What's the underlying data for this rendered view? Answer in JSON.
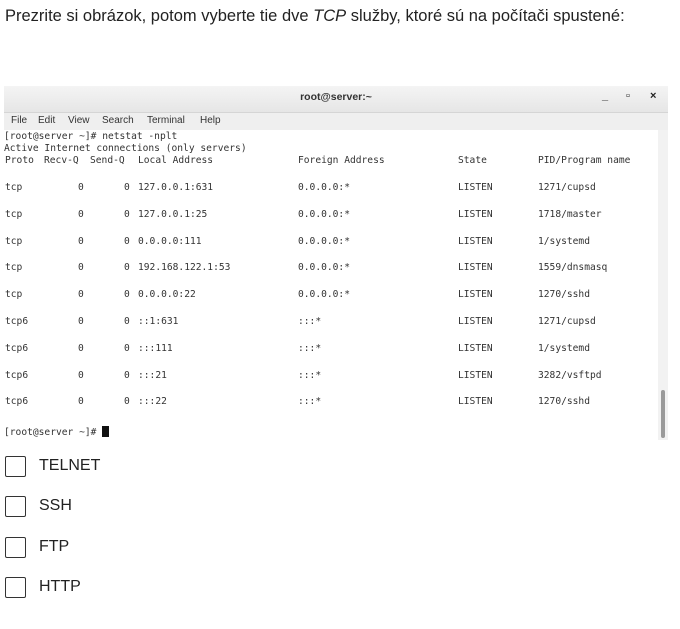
{
  "question": {
    "text_before": "Prezrite si obrázok, potom vyberte tie dve ",
    "text_emphasis": "TCP",
    "text_after": " služby, ktoré sú na počítači spustené:"
  },
  "terminal": {
    "title": "root@server:~",
    "window_controls": [
      "_",
      "▫",
      "×"
    ],
    "menu": [
      "File",
      "Edit",
      "View",
      "Search",
      "Terminal",
      "Help"
    ],
    "command_line": "[root@server ~]# netstat -nplt",
    "active_line": "Active Internet connections (only servers)",
    "headers": {
      "proto": "Proto",
      "recvq": "Recv-Q",
      "sendq": "Send-Q",
      "local": "Local Address",
      "foreign": "Foreign Address",
      "state": "State",
      "pid": "PID/Program name"
    },
    "rows": [
      {
        "proto": "tcp",
        "recvq": "0",
        "sendq": "0",
        "local": "127.0.0.1:631",
        "foreign": "0.0.0.0:*",
        "state": "LISTEN",
        "pid": "1271/cupsd"
      },
      {
        "proto": "tcp",
        "recvq": "0",
        "sendq": "0",
        "local": "127.0.0.1:25",
        "foreign": "0.0.0.0:*",
        "state": "LISTEN",
        "pid": "1718/master"
      },
      {
        "proto": "tcp",
        "recvq": "0",
        "sendq": "0",
        "local": "0.0.0.0:111",
        "foreign": "0.0.0.0:*",
        "state": "LISTEN",
        "pid": "1/systemd"
      },
      {
        "proto": "tcp",
        "recvq": "0",
        "sendq": "0",
        "local": "192.168.122.1:53",
        "foreign": "0.0.0.0:*",
        "state": "LISTEN",
        "pid": "1559/dnsmasq"
      },
      {
        "proto": "tcp",
        "recvq": "0",
        "sendq": "0",
        "local": "0.0.0.0:22",
        "foreign": "0.0.0.0:*",
        "state": "LISTEN",
        "pid": "1270/sshd"
      },
      {
        "proto": "tcp6",
        "recvq": "0",
        "sendq": "0",
        "local": "::1:631",
        "foreign": ":::*",
        "state": "LISTEN",
        "pid": "1271/cupsd"
      },
      {
        "proto": "tcp6",
        "recvq": "0",
        "sendq": "0",
        "local": ":::111",
        "foreign": ":::*",
        "state": "LISTEN",
        "pid": "1/systemd"
      },
      {
        "proto": "tcp6",
        "recvq": "0",
        "sendq": "0",
        "local": ":::21",
        "foreign": ":::*",
        "state": "LISTEN",
        "pid": "3282/vsftpd"
      },
      {
        "proto": "tcp6",
        "recvq": "0",
        "sendq": "0",
        "local": ":::22",
        "foreign": ":::*",
        "state": "LISTEN",
        "pid": "1270/sshd"
      }
    ],
    "prompt": "[root@server ~]# "
  },
  "options": [
    {
      "label": "TELNET"
    },
    {
      "label": "SSH"
    },
    {
      "label": "FTP"
    },
    {
      "label": "HTTP"
    }
  ]
}
